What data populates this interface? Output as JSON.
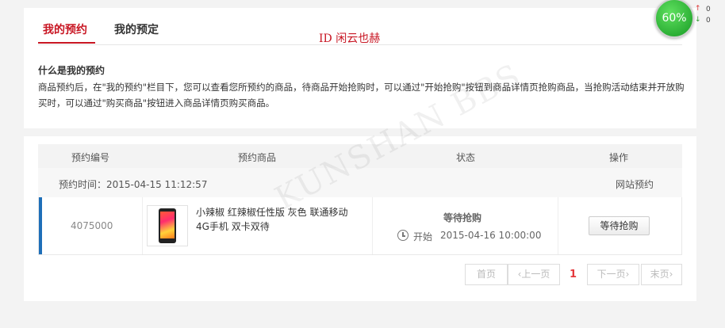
{
  "tabs": [
    {
      "label": "我的预约"
    },
    {
      "label": "我的预定"
    }
  ],
  "overlay_id": "ID 闲云也赫",
  "info": {
    "title": "什么是我的预约",
    "text": "商品预约后，在\"我的预约\"栏目下，您可以查看您所预约的商品，待商品开始抢购时，可以通过\"开始抢购\"按钮到商品详情页抢购商品，当抢购活动结束并开放购买时，可以通过\"购买商品\"按钮进入商品详情页购买商品。"
  },
  "table": {
    "headers": [
      "预约编号",
      "预约商品",
      "状态",
      "操作"
    ],
    "group": {
      "time_label": "预约时间：2015-04-15 11:12:57",
      "source": "网站预约"
    },
    "row": {
      "order_id": "4075000",
      "product": "小辣椒 红辣椒任性版 灰色 联通移动4G手机 双卡双待",
      "status": "等待抢购",
      "start_label": "开始",
      "start_time": "2015-04-16 10:00:00",
      "action": "等待抢购"
    }
  },
  "pager": {
    "first": "首页",
    "prev": "上一页",
    "current": "1",
    "next": "下一页",
    "last": "末页"
  },
  "widget": {
    "percent": "60%",
    "up_arrow": "↑",
    "down_arrow": "↓",
    "up_value": "0",
    "down_value": "0"
  },
  "watermark": "KUNSHAN BBS",
  "colors": {
    "accent": "#c81623",
    "row_accent": "#1e6fb8",
    "pager_current": "#e4393c"
  }
}
